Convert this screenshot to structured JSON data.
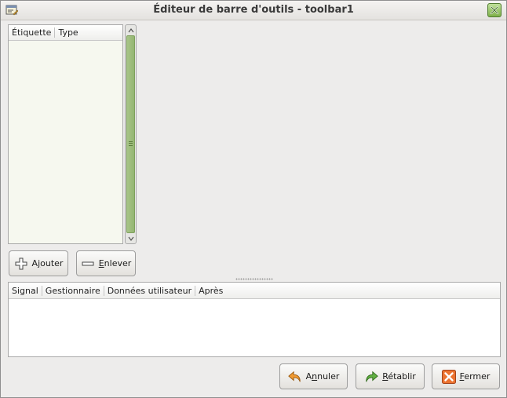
{
  "window": {
    "title": "Éditeur de barre d'outils - toolbar1"
  },
  "icons": {
    "app": "toolbar-editor-icon",
    "close": "close-icon",
    "add": "plus-icon",
    "remove": "minus-icon",
    "undo": "undo-arrow-icon",
    "redo": "redo-arrow-icon",
    "close_dialog": "close-x-icon"
  },
  "tree": {
    "columns": [
      "Étiquette",
      "Type"
    ],
    "rows": []
  },
  "buttons": {
    "add_prefix": "A",
    "add_underline": "j",
    "add_rest": "outer",
    "remove_prefix": "",
    "remove_underline": "E",
    "remove_rest": "nlever"
  },
  "signals": {
    "columns": [
      "Signal",
      "Gestionnaire",
      "Données utilisateur",
      "Après"
    ],
    "rows": []
  },
  "footer": {
    "undo_prefix": "A",
    "undo_underline": "n",
    "undo_rest": "nuler",
    "redo_prefix": "",
    "redo_underline": "R",
    "redo_rest": "établir",
    "close_prefix": "",
    "close_underline": "F",
    "close_rest": "ermer"
  },
  "colors": {
    "scrollbar_thumb": "#9ab97a",
    "close_button": "#8fbf5a",
    "undo_arrow": "#e8932c",
    "redo_arrow": "#5aa43a",
    "close_x_bg": "#e86b2a"
  }
}
